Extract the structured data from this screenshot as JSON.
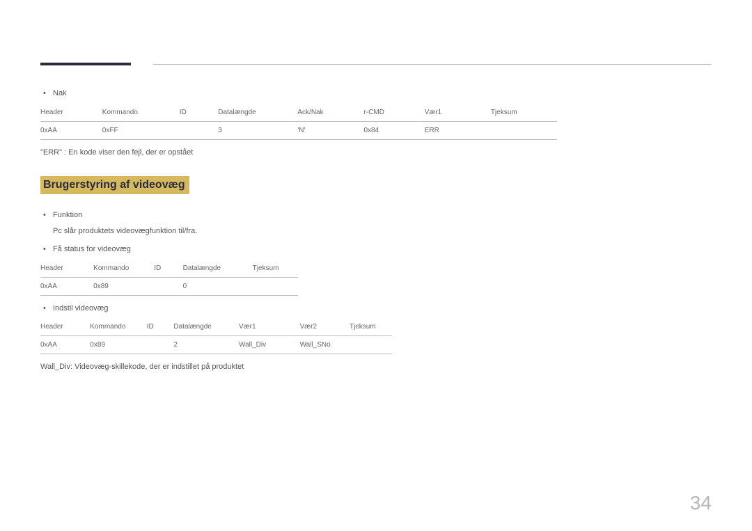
{
  "nak": {
    "bullet": "Nak",
    "table": {
      "headers": [
        "Header",
        "Kommando",
        "ID",
        "Datalængde",
        "Ack/Nak",
        "r-CMD",
        "Vær1",
        "Tjeksum"
      ],
      "row": [
        "0xAA",
        "0xFF",
        "",
        "3",
        "'N'",
        "0x84",
        "ERR",
        ""
      ]
    },
    "note": "\"ERR\" : En kode viser den fejl, der er opstået"
  },
  "section_title": "Brugerstyring af videovæg",
  "funktion": {
    "bullet": "Funktion",
    "sub": "Pc slår produktets videovægfunktion til/fra."
  },
  "get_status": {
    "bullet": "Få status for videovæg",
    "table": {
      "headers": [
        "Header",
        "Kommando",
        "ID",
        "Datalængde",
        "Tjeksum"
      ],
      "row": [
        "0xAA",
        "0x89",
        "",
        "0",
        ""
      ]
    }
  },
  "set_wall": {
    "bullet": "Indstil videovæg",
    "table": {
      "headers": [
        "Header",
        "Kommando",
        "ID",
        "Datalængde",
        "Vær1",
        "Vær2",
        "Tjeksum"
      ],
      "row": [
        "0xAA",
        "0x89",
        "",
        "2",
        "Wall_Div",
        "Wall_SNo",
        ""
      ]
    }
  },
  "wall_div_note": "Wall_Div: Videovæg-skillekode, der er indstillet på produktet",
  "page_number": "34"
}
